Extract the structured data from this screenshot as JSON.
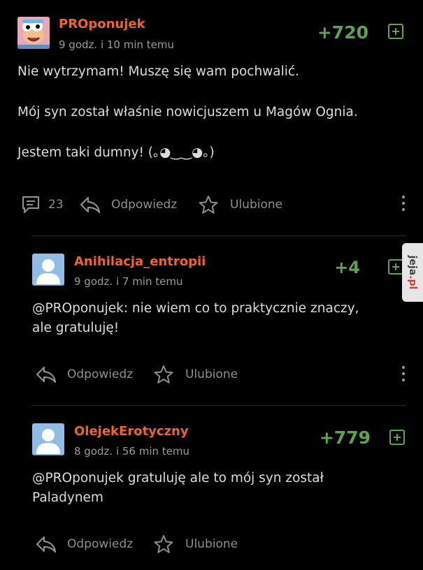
{
  "comments": [
    {
      "username": "PROponujek",
      "time": "9 godz. i 10 min temu",
      "score": "+720",
      "paragraphs": [
        "Nie wytrzymam! Muszę się wam pochwalić.",
        "Mój syn został właśnie nowicjuszem u Magów Ognia.",
        "Jestem taki dumny! (｡◕‿‿◕｡)"
      ],
      "reply_count": "23",
      "reply_label": "Odpowiedz",
      "fav_label": "Ulubione"
    },
    {
      "username": "Anihilacja_entropii",
      "time": "9 godz. i 7 min temu",
      "score": "+4",
      "text": "@PROponujek: nie wiem co to praktycznie znaczy,\nale gratuluję!",
      "reply_label": "Odpowiedz",
      "fav_label": "Ulubione"
    },
    {
      "username": "OlejekErotyczny",
      "time": "8 godz. i 56 min temu",
      "score": "+779",
      "text": "@PROponujek gratuluję ale to mój syn został\nPaladynem",
      "reply_label": "Odpowiedz",
      "fav_label": "Ulubione"
    }
  ],
  "watermark": {
    "prefix": "jeja",
    "suffix": ".pl"
  },
  "colors": {
    "username": "#f1632d",
    "score": "#5da352",
    "background": "#000000"
  }
}
